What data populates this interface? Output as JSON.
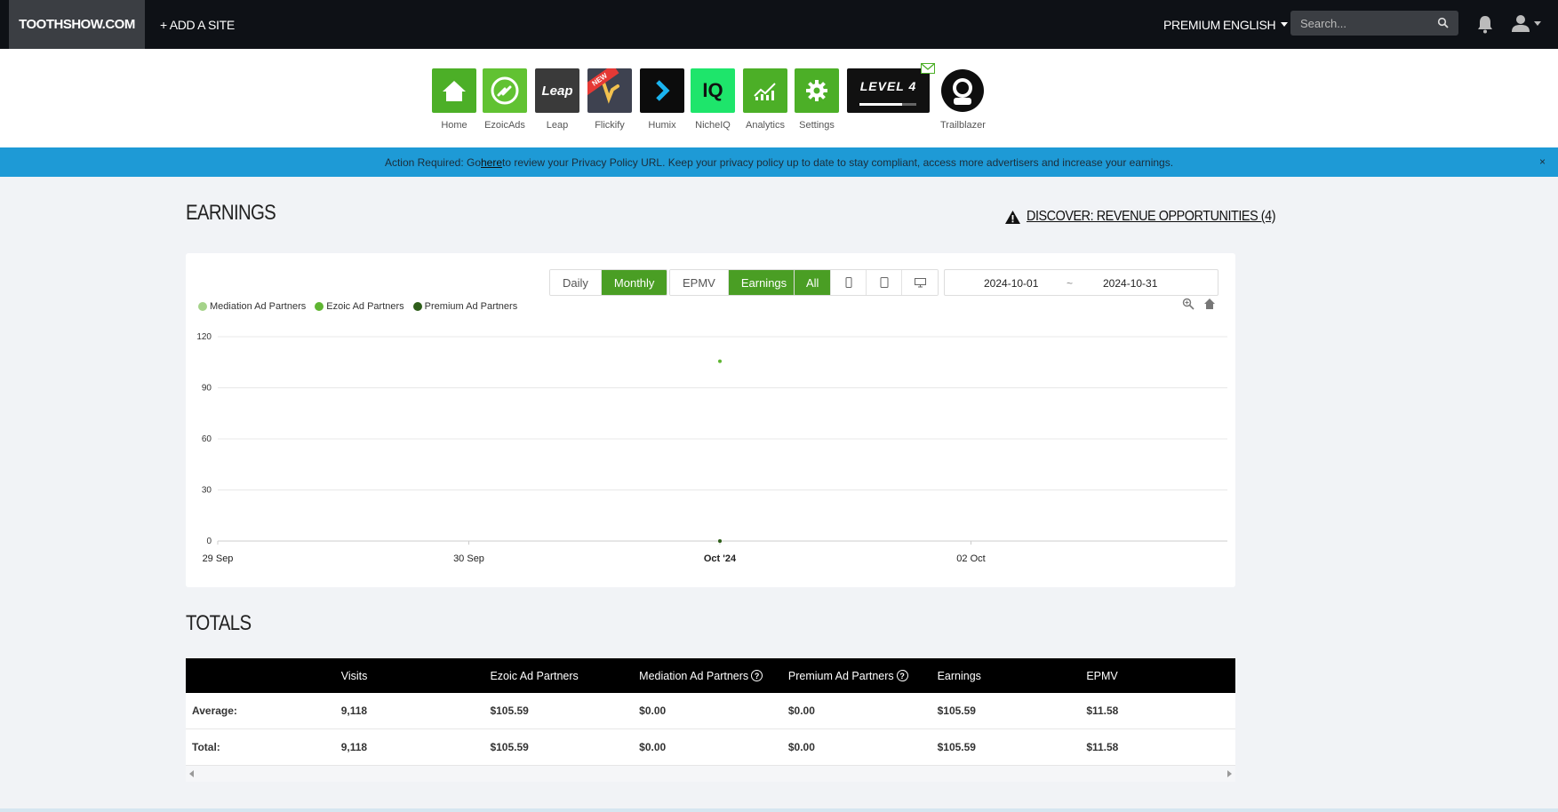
{
  "topbar": {
    "site_name": "TOOTHSHOW.COM",
    "add_site": "+ ADD A SITE",
    "premium": "PREMIUM",
    "language": "ENGLISH",
    "search_placeholder": "Search..."
  },
  "apps": [
    {
      "label": "Home",
      "color": "#4caf27",
      "icon": "home-icon"
    },
    {
      "label": "EzoicAds",
      "color": "#61c232",
      "icon": "ezoicads-icon"
    },
    {
      "label": "Leap",
      "color": "#3a3a3a",
      "icon": "leap-icon",
      "icon_text": "Leap"
    },
    {
      "label": "Flickify",
      "color": "#3e4250",
      "icon": "flickify-icon",
      "badge": "NEW"
    },
    {
      "label": "Humix",
      "color": "#0c0c0c",
      "icon": "humix-icon"
    },
    {
      "label": "NicheIQ",
      "color": "#1ee56b",
      "icon": "nicheiq-icon",
      "icon_text": "IQ"
    },
    {
      "label": "Analytics",
      "color": "#4caf27",
      "icon": "analytics-icon"
    },
    {
      "label": "Settings",
      "color": "#4caf27",
      "icon": "gear-icon"
    },
    {
      "label": "",
      "icon": "level-badge",
      "icon_text": "LEVEL 4",
      "progress": 0.75
    },
    {
      "label": "Trailblazer",
      "icon": "trailblazer-icon"
    }
  ],
  "alert": {
    "before": "Action Required: Go ",
    "link": "here",
    "after": " to review your Privacy Policy URL. Keep your privacy policy up to date to stay compliant, access more advertisers and increase your earnings.",
    "close": "×"
  },
  "earnings": {
    "title": "EARNINGS",
    "discover": "DISCOVER: REVENUE OPPORTUNITIES (4)"
  },
  "controls": {
    "period": [
      "Daily",
      "Monthly"
    ],
    "period_active": "Monthly",
    "metric": [
      "EPMV",
      "Earnings"
    ],
    "metric_active": "Earnings",
    "device": [
      "All",
      "mobile-icon",
      "tablet-icon",
      "desktop-icon"
    ],
    "device_active": "All",
    "date_start": "2024-10-01",
    "date_sep": "~",
    "date_end": "2024-10-31"
  },
  "chart_data": {
    "type": "line",
    "legend": [
      {
        "name": "Mediation Ad Partners",
        "color": "#a5d38a"
      },
      {
        "name": "Ezoic Ad Partners",
        "color": "#5fb532"
      },
      {
        "name": "Premium Ad Partners",
        "color": "#2e5e1a"
      }
    ],
    "x_ticks": [
      "29 Sep",
      "30 Sep",
      "Oct '24",
      "02 Oct"
    ],
    "y_ticks": [
      0,
      30,
      60,
      90,
      120
    ],
    "ylim": [
      0,
      120
    ],
    "series": [
      {
        "name": "Mediation Ad Partners",
        "points": [
          {
            "x": "Oct '24",
            "y": 0
          }
        ]
      },
      {
        "name": "Ezoic Ad Partners",
        "points": [
          {
            "x": "Oct '24",
            "y": 105.59
          }
        ]
      },
      {
        "name": "Premium Ad Partners",
        "points": [
          {
            "x": "Oct '24",
            "y": 0
          }
        ]
      }
    ],
    "grid": true
  },
  "totals": {
    "title": "TOTALS",
    "headers": [
      "",
      "Visits",
      "Ezoic Ad Partners",
      "Mediation Ad Partners",
      "Premium Ad Partners",
      "Earnings",
      "EPMV"
    ],
    "rows": [
      [
        "Average:",
        "9,118",
        "$105.59",
        "$0.00",
        "$0.00",
        "$105.59",
        "$11.58"
      ],
      [
        "Total:",
        "9,118",
        "$105.59",
        "$0.00",
        "$0.00",
        "$105.59",
        "$11.58"
      ]
    ]
  }
}
